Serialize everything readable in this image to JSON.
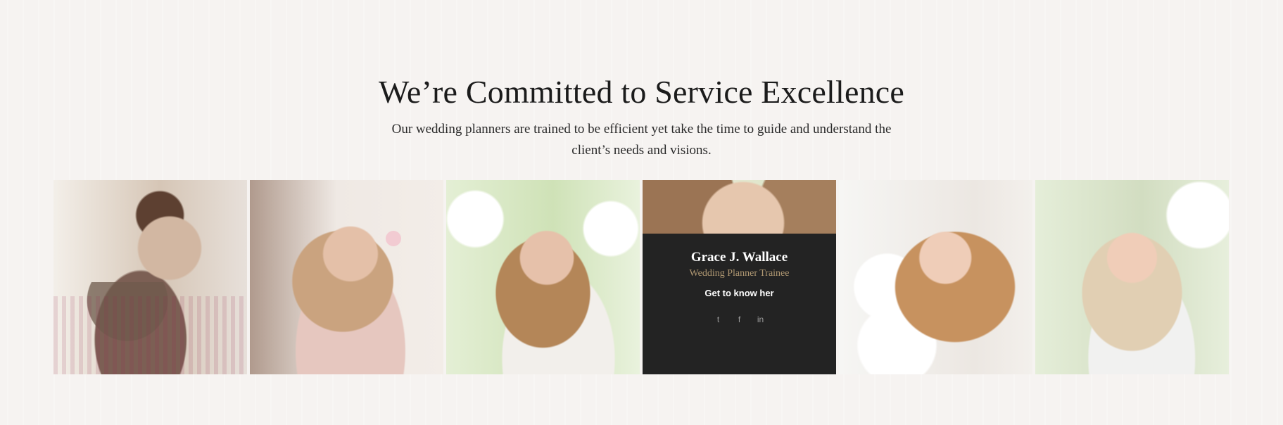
{
  "section": {
    "title": "We’re Committed to Service Excellence",
    "subtitle": "Our wedding planners are trained to be efficient yet take the time to guide and understand the client’s needs and visions."
  },
  "team": [
    {
      "photo": "man-portrait-photo",
      "palette": [
        "#f1eee9",
        "#d0c3b6",
        "#7b5b4b",
        "#8e6c5b"
      ]
    },
    {
      "photo": "woman-blonde-pink-coat-photo",
      "palette": [
        "#f0ece8",
        "#d8c3b6",
        "#b78f72",
        "#f2d6cc"
      ]
    },
    {
      "photo": "woman-blossom-tree-photo",
      "palette": [
        "#eef3e4",
        "#d7e6c4",
        "#9aae73",
        "#f3f0ee"
      ]
    },
    {
      "photo": "woman-smiling-photo",
      "palette": [
        "#f0ead6",
        "#d8c1a3",
        "#8d6b4b",
        "#d4e2b9"
      ],
      "highlighted": true,
      "name": "Grace J. Wallace",
      "role": "Wedding Planner Trainee",
      "link_label": "Get to know her",
      "socials": [
        {
          "icon": "twitter-icon",
          "glyph": "t"
        },
        {
          "icon": "facebook-icon",
          "glyph": "f"
        },
        {
          "icon": "linkedin-icon",
          "glyph": "in"
        }
      ]
    },
    {
      "photo": "woman-flowers-photo",
      "palette": [
        "#f5f5f2",
        "#e7e2dc",
        "#caa27a",
        "#f2eee9"
      ]
    },
    {
      "photo": "woman-long-hair-photo",
      "palette": [
        "#e8efe1",
        "#cfd8bd",
        "#d7c3a6",
        "#f0f0ef"
      ]
    }
  ],
  "colors": {
    "background": "#f6f3f1",
    "overlay": "#232323",
    "accent": "#b09872"
  }
}
